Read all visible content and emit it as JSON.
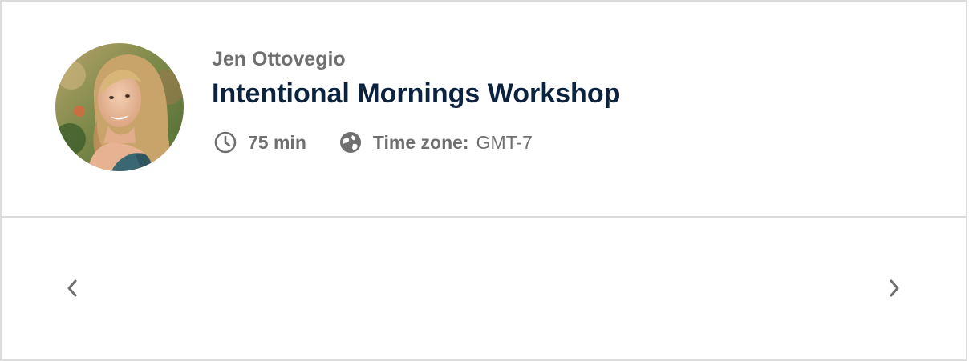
{
  "host": {
    "name": "Jen Ottovegio"
  },
  "event": {
    "title": "Intentional Mornings Workshop",
    "duration": "75 min",
    "timezone_label": "Time zone:",
    "timezone_value": "GMT-7"
  },
  "icons": {
    "duration": "clock-icon",
    "timezone": "globe-icon",
    "previous": "chevron-left-icon",
    "next": "chevron-right-icon"
  },
  "colors": {
    "title": "#0c2340",
    "muted": "#6f6f6f",
    "border": "#dcdcdc",
    "background": "#ffffff"
  }
}
